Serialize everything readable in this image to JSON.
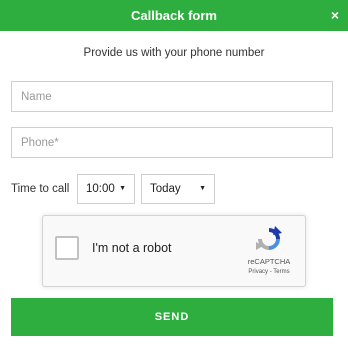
{
  "header": {
    "title": "Callback form",
    "close_symbol": "×",
    "bg_color": "#2fae40"
  },
  "subtitle": "Provide us with your phone number",
  "form": {
    "name_placeholder": "Name",
    "name_value": "",
    "phone_placeholder": "Phone*",
    "phone_value": "",
    "time_label": "Time to call",
    "time_select": {
      "selected": "10:00",
      "caret": "▼"
    },
    "day_select": {
      "selected": "Today",
      "caret": "▼"
    }
  },
  "recaptcha": {
    "checkbox_label": "I'm not a robot",
    "checked": false,
    "brand": "reCAPTCHA",
    "links": "Privacy - Terms",
    "icon": "recaptcha-logo-icon"
  },
  "send_button": {
    "label": "SEND",
    "bg_color": "#2fae40"
  }
}
